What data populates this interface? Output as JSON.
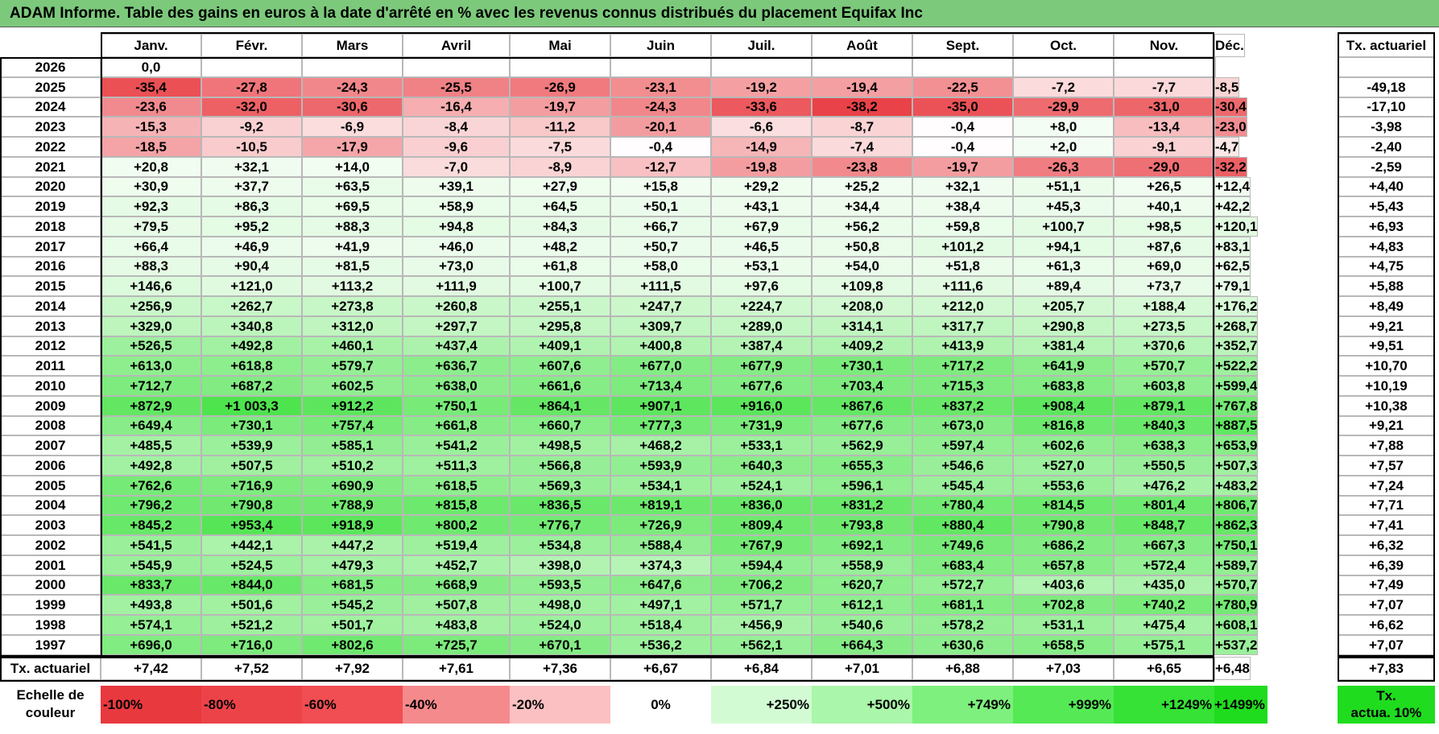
{
  "title": "ADAM Informe. Table des gains en euros à la date d'arrêté en % avec les revenus connus distribués du placement Equifax Inc",
  "months": [
    "Janv.",
    "Févr.",
    "Mars",
    "Avril",
    "Mai",
    "Juin",
    "Juil.",
    "Août",
    "Sept.",
    "Oct.",
    "Nov.",
    "Déc."
  ],
  "actuarial_header": "Tx. actuariel",
  "rows": [
    {
      "year": "2026",
      "values": [
        "0,0",
        "",
        "",
        "",
        "",
        "",
        "",
        "",
        "",
        "",
        "",
        ""
      ],
      "actuarial": ""
    },
    {
      "year": "2025",
      "values": [
        "-35,4",
        "-27,8",
        "-24,3",
        "-25,5",
        "-26,9",
        "-23,1",
        "-19,2",
        "-19,4",
        "-22,5",
        "-7,2",
        "-7,7",
        "-8,5"
      ],
      "actuarial": "-49,18"
    },
    {
      "year": "2024",
      "values": [
        "-23,6",
        "-32,0",
        "-30,6",
        "-16,4",
        "-19,7",
        "-24,3",
        "-33,6",
        "-38,2",
        "-35,0",
        "-29,9",
        "-31,0",
        "-30,4"
      ],
      "actuarial": "-17,10"
    },
    {
      "year": "2023",
      "values": [
        "-15,3",
        "-9,2",
        "-6,9",
        "-8,4",
        "-11,2",
        "-20,1",
        "-6,6",
        "-8,7",
        "-0,4",
        "+8,0",
        "-13,4",
        "-23,0"
      ],
      "actuarial": "-3,98"
    },
    {
      "year": "2022",
      "values": [
        "-18,5",
        "-10,5",
        "-17,9",
        "-9,6",
        "-7,5",
        "-0,4",
        "-14,9",
        "-7,4",
        "-0,4",
        "+2,0",
        "-9,1",
        "-4,7"
      ],
      "actuarial": "-2,40"
    },
    {
      "year": "2021",
      "values": [
        "+20,8",
        "+32,1",
        "+14,0",
        "-7,0",
        "-8,9",
        "-12,7",
        "-19,8",
        "-23,8",
        "-19,7",
        "-26,3",
        "-29,0",
        "-32,2"
      ],
      "actuarial": "-2,59"
    },
    {
      "year": "2020",
      "values": [
        "+30,9",
        "+37,7",
        "+63,5",
        "+39,1",
        "+27,9",
        "+15,8",
        "+29,2",
        "+25,2",
        "+32,1",
        "+51,1",
        "+26,5",
        "+12,4"
      ],
      "actuarial": "+4,40"
    },
    {
      "year": "2019",
      "values": [
        "+92,3",
        "+86,3",
        "+69,5",
        "+58,9",
        "+64,5",
        "+50,1",
        "+43,1",
        "+34,4",
        "+38,4",
        "+45,3",
        "+40,1",
        "+42,2"
      ],
      "actuarial": "+5,43"
    },
    {
      "year": "2018",
      "values": [
        "+79,5",
        "+95,2",
        "+88,3",
        "+94,8",
        "+84,3",
        "+66,7",
        "+67,9",
        "+56,2",
        "+59,8",
        "+100,7",
        "+98,5",
        "+120,1"
      ],
      "actuarial": "+6,93"
    },
    {
      "year": "2017",
      "values": [
        "+66,4",
        "+46,9",
        "+41,9",
        "+46,0",
        "+48,2",
        "+50,7",
        "+46,5",
        "+50,8",
        "+101,2",
        "+94,1",
        "+87,6",
        "+83,1"
      ],
      "actuarial": "+4,83"
    },
    {
      "year": "2016",
      "values": [
        "+88,3",
        "+90,4",
        "+81,5",
        "+73,0",
        "+61,8",
        "+58,0",
        "+53,1",
        "+54,0",
        "+51,8",
        "+61,3",
        "+69,0",
        "+62,5"
      ],
      "actuarial": "+4,75"
    },
    {
      "year": "2015",
      "values": [
        "+146,6",
        "+121,0",
        "+113,2",
        "+111,9",
        "+100,7",
        "+111,5",
        "+97,6",
        "+109,8",
        "+111,6",
        "+89,4",
        "+73,7",
        "+79,1"
      ],
      "actuarial": "+5,88"
    },
    {
      "year": "2014",
      "values": [
        "+256,9",
        "+262,7",
        "+273,8",
        "+260,8",
        "+255,1",
        "+247,7",
        "+224,7",
        "+208,0",
        "+212,0",
        "+205,7",
        "+188,4",
        "+176,2"
      ],
      "actuarial": "+8,49"
    },
    {
      "year": "2013",
      "values": [
        "+329,0",
        "+340,8",
        "+312,0",
        "+297,7",
        "+295,8",
        "+309,7",
        "+289,0",
        "+314,1",
        "+317,7",
        "+290,8",
        "+273,5",
        "+268,7"
      ],
      "actuarial": "+9,21"
    },
    {
      "year": "2012",
      "values": [
        "+526,5",
        "+492,8",
        "+460,1",
        "+437,4",
        "+409,1",
        "+400,8",
        "+387,4",
        "+409,2",
        "+413,9",
        "+381,4",
        "+370,6",
        "+352,7"
      ],
      "actuarial": "+9,51"
    },
    {
      "year": "2011",
      "values": [
        "+613,0",
        "+618,8",
        "+579,7",
        "+636,7",
        "+607,6",
        "+677,0",
        "+677,9",
        "+730,1",
        "+717,2",
        "+641,9",
        "+570,7",
        "+522,2"
      ],
      "actuarial": "+10,70"
    },
    {
      "year": "2010",
      "values": [
        "+712,7",
        "+687,2",
        "+602,5",
        "+638,0",
        "+661,6",
        "+713,4",
        "+677,6",
        "+703,4",
        "+715,3",
        "+683,8",
        "+603,8",
        "+599,4"
      ],
      "actuarial": "+10,19"
    },
    {
      "year": "2009",
      "values": [
        "+872,9",
        "+1 003,3",
        "+912,2",
        "+750,1",
        "+864,1",
        "+907,1",
        "+916,0",
        "+867,6",
        "+837,2",
        "+908,4",
        "+879,1",
        "+767,8"
      ],
      "actuarial": "+10,38"
    },
    {
      "year": "2008",
      "values": [
        "+649,4",
        "+730,1",
        "+757,4",
        "+661,8",
        "+660,7",
        "+777,3",
        "+731,9",
        "+677,6",
        "+673,0",
        "+816,8",
        "+840,3",
        "+887,5"
      ],
      "actuarial": "+9,21"
    },
    {
      "year": "2007",
      "values": [
        "+485,5",
        "+539,9",
        "+585,1",
        "+541,2",
        "+498,5",
        "+468,2",
        "+533,1",
        "+562,9",
        "+597,4",
        "+602,6",
        "+638,3",
        "+653,9"
      ],
      "actuarial": "+7,88"
    },
    {
      "year": "2006",
      "values": [
        "+492,8",
        "+507,5",
        "+510,2",
        "+511,3",
        "+566,8",
        "+593,9",
        "+640,3",
        "+655,3",
        "+546,6",
        "+527,0",
        "+550,5",
        "+507,3"
      ],
      "actuarial": "+7,57"
    },
    {
      "year": "2005",
      "values": [
        "+762,6",
        "+716,9",
        "+690,9",
        "+618,5",
        "+569,3",
        "+534,1",
        "+524,1",
        "+596,1",
        "+545,4",
        "+553,6",
        "+476,2",
        "+483,2"
      ],
      "actuarial": "+7,24"
    },
    {
      "year": "2004",
      "values": [
        "+796,2",
        "+790,8",
        "+788,9",
        "+815,8",
        "+836,5",
        "+819,1",
        "+836,0",
        "+831,2",
        "+780,4",
        "+814,5",
        "+801,4",
        "+806,7"
      ],
      "actuarial": "+7,71"
    },
    {
      "year": "2003",
      "values": [
        "+845,2",
        "+953,4",
        "+918,9",
        "+800,2",
        "+776,7",
        "+726,9",
        "+809,4",
        "+793,8",
        "+880,4",
        "+790,8",
        "+848,7",
        "+862,3"
      ],
      "actuarial": "+7,41"
    },
    {
      "year": "2002",
      "values": [
        "+541,5",
        "+442,1",
        "+447,2",
        "+519,4",
        "+534,8",
        "+588,4",
        "+767,9",
        "+692,1",
        "+749,6",
        "+686,2",
        "+667,3",
        "+750,1"
      ],
      "actuarial": "+6,32"
    },
    {
      "year": "2001",
      "values": [
        "+545,9",
        "+524,5",
        "+479,3",
        "+452,7",
        "+398,0",
        "+374,3",
        "+594,4",
        "+558,9",
        "+683,4",
        "+657,8",
        "+572,4",
        "+589,7"
      ],
      "actuarial": "+6,39"
    },
    {
      "year": "2000",
      "values": [
        "+833,7",
        "+844,0",
        "+681,5",
        "+668,9",
        "+593,5",
        "+647,6",
        "+706,2",
        "+620,7",
        "+572,7",
        "+403,6",
        "+435,0",
        "+570,7"
      ],
      "actuarial": "+7,49"
    },
    {
      "year": "1999",
      "values": [
        "+493,8",
        "+501,6",
        "+545,2",
        "+507,8",
        "+498,0",
        "+497,1",
        "+571,7",
        "+612,1",
        "+681,1",
        "+702,8",
        "+740,2",
        "+780,9"
      ],
      "actuarial": "+7,07"
    },
    {
      "year": "1998",
      "values": [
        "+574,1",
        "+521,2",
        "+501,7",
        "+483,8",
        "+524,0",
        "+518,4",
        "+456,9",
        "+540,6",
        "+578,2",
        "+531,1",
        "+475,4",
        "+608,1"
      ],
      "actuarial": "+6,62"
    },
    {
      "year": "1997",
      "values": [
        "+696,0",
        "+716,0",
        "+802,6",
        "+725,7",
        "+670,1",
        "+536,2",
        "+562,1",
        "+664,3",
        "+630,6",
        "+658,5",
        "+575,1",
        "+537,2"
      ],
      "actuarial": "+7,07"
    }
  ],
  "footer": {
    "label": "Tx. actuariel",
    "values": [
      "+7,42",
      "+7,52",
      "+7,92",
      "+7,61",
      "+7,36",
      "+6,67",
      "+6,84",
      "+7,01",
      "+6,88",
      "+7,03",
      "+6,65",
      "+6,48"
    ],
    "actuarial": "+7,83"
  },
  "scale": {
    "label_line1": "Echelle de",
    "label_line2": "couleur",
    "steps": [
      {
        "label": "-100%",
        "color": "#e8393f",
        "align": "left"
      },
      {
        "label": "-80%",
        "color": "#ec4349",
        "align": "left"
      },
      {
        "label": "-60%",
        "color": "#f04e53",
        "align": "left"
      },
      {
        "label": "-40%",
        "color": "#f58a8d",
        "align": "left"
      },
      {
        "label": "-20%",
        "color": "#fbc0c2",
        "align": "left"
      },
      {
        "label": "0%",
        "color": "#ffffff",
        "align": "center"
      },
      {
        "label": "+250%",
        "color": "#d3fbd3",
        "align": "right"
      },
      {
        "label": "+500%",
        "color": "#aaf6aa",
        "align": "right"
      },
      {
        "label": "+749%",
        "color": "#7df07d",
        "align": "right"
      },
      {
        "label": "+999%",
        "color": "#55ea55",
        "align": "right"
      },
      {
        "label": "+1249%",
        "color": "#35e235",
        "align": "right"
      },
      {
        "label": "+1499%",
        "color": "#1fdc1f",
        "align": "right"
      }
    ],
    "target_line1": "Tx.",
    "target_line2": "actua. 10%",
    "target_color": "#1fdc1f"
  },
  "colors": {
    "title_bg": "#7cc97c",
    "negative_base": "#e8393f",
    "positive_base": "#21dd21"
  }
}
